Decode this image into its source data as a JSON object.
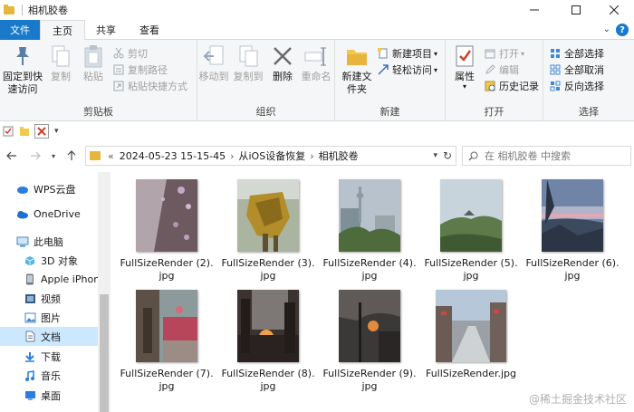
{
  "window": {
    "title": "相机胶卷",
    "controls": [
      "minimize",
      "maximize",
      "close"
    ]
  },
  "tabs": [
    {
      "label": "文件"
    },
    {
      "label": "主页"
    },
    {
      "label": "共享"
    },
    {
      "label": "查看"
    }
  ],
  "ribbon": {
    "clipboard": {
      "label": "剪贴板",
      "pin": "固定到快速访问",
      "copy": "复制",
      "paste": "粘贴",
      "cut": "剪切",
      "copy_path": "复制路径",
      "paste_shortcut": "粘贴快捷方式"
    },
    "organize": {
      "label": "组织",
      "move_to": "移动到",
      "copy_to": "复制到",
      "delete": "删除",
      "rename": "重命名"
    },
    "new": {
      "label": "新建",
      "new_folder": "新建文件夹",
      "new_item": "新建项目",
      "easy_access": "轻松访问"
    },
    "open": {
      "label": "打开",
      "properties": "属性",
      "open": "打开",
      "edit": "编辑",
      "history": "历史记录"
    },
    "select": {
      "label": "选择",
      "select_all": "全部选择",
      "select_none": "全部取消",
      "invert": "反向选择"
    }
  },
  "address": {
    "segments": [
      "2024-05-23 15-15-45",
      "从iOS设备恢复",
      "相机胶卷"
    ],
    "search_placeholder": "在 相机胶卷 中搜索"
  },
  "nav": [
    {
      "label": "WPS云盘",
      "icon": "cloud-icon"
    },
    {
      "label": "OneDrive",
      "icon": "onedrive-icon"
    },
    {
      "label": "此电脑",
      "icon": "computer-icon"
    },
    {
      "label": "3D 对象",
      "icon": "cube-icon"
    },
    {
      "label": "Apple iPhone",
      "icon": "phone-icon"
    },
    {
      "label": "视频",
      "icon": "video-icon"
    },
    {
      "label": "图片",
      "icon": "picture-icon"
    },
    {
      "label": "文档",
      "icon": "document-icon"
    },
    {
      "label": "下载",
      "icon": "download-icon"
    },
    {
      "label": "音乐",
      "icon": "music-icon"
    },
    {
      "label": "桌面",
      "icon": "desktop-icon"
    }
  ],
  "files": [
    {
      "name": "FullSizeRender (2).jpg"
    },
    {
      "name": "FullSizeRender (3).jpg"
    },
    {
      "name": "FullSizeRender (4).jpg"
    },
    {
      "name": "FullSizeRender (5).jpg"
    },
    {
      "name": "FullSizeRender (6).jpg"
    },
    {
      "name": "FullSizeRender (7).jpg"
    },
    {
      "name": "FullSizeRender (8).jpg"
    },
    {
      "name": "FullSizeRender (9).jpg"
    },
    {
      "name": "FullSizeRender.jpg"
    }
  ],
  "watermark": "@稀土掘金技术社区"
}
